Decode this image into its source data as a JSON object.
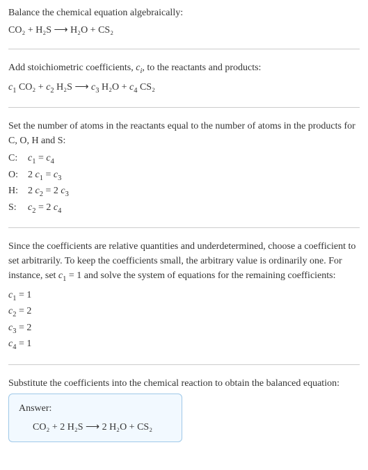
{
  "sec1": {
    "title": "Balance the chemical equation algebraically:",
    "eq": "CO₂ + H₂S ⟶ H₂O + CS₂"
  },
  "sec2": {
    "title_a": "Add stoichiometric coefficients, ",
    "title_ci": "c",
    "title_isub": "i",
    "title_b": ", to the reactants and products:",
    "c1": "c",
    "c1s": "1",
    "r1": " CO₂ + ",
    "c2": "c",
    "c2s": "2",
    "r2": " H₂S ⟶ ",
    "c3": "c",
    "c3s": "3",
    "r3": " H₂O + ",
    "c4": "c",
    "c4s": "4",
    "r4": " CS₂"
  },
  "sec3": {
    "title": "Set the number of atoms in the reactants equal to the number of atoms in the products for C, O, H and S:",
    "rows": [
      {
        "label": "C:",
        "lhs_c": "c",
        "lhs_s": "1",
        "eq": " = ",
        "rhs_c": "c",
        "rhs_s": "4",
        "pre": "",
        "rpre": ""
      },
      {
        "label": "O:",
        "lhs_c": "c",
        "lhs_s": "1",
        "eq": " = ",
        "rhs_c": "c",
        "rhs_s": "3",
        "pre": "2 ",
        "rpre": ""
      },
      {
        "label": "H:",
        "lhs_c": "c",
        "lhs_s": "2",
        "eq": " = ",
        "rhs_c": "c",
        "rhs_s": "3",
        "pre": "2 ",
        "rpre": "2 "
      },
      {
        "label": "S:",
        "lhs_c": "c",
        "lhs_s": "2",
        "eq": " = ",
        "rhs_c": "c",
        "rhs_s": "4",
        "pre": "",
        "rpre": "2 "
      }
    ]
  },
  "sec4": {
    "text_a": "Since the coefficients are relative quantities and underdetermined, choose a coefficient to set arbitrarily. To keep the coefficients small, the arbitrary value is ordinarily one. For instance, set ",
    "c1": "c",
    "c1s": "1",
    "text_b": " = 1 and solve the system of equations for the remaining coefficients:",
    "lines": [
      {
        "c": "c",
        "s": "1",
        "v": " = 1"
      },
      {
        "c": "c",
        "s": "2",
        "v": " = 2"
      },
      {
        "c": "c",
        "s": "3",
        "v": " = 2"
      },
      {
        "c": "c",
        "s": "4",
        "v": " = 1"
      }
    ]
  },
  "sec5": {
    "title": "Substitute the coefficients into the chemical reaction to obtain the balanced equation:",
    "answer_label": "Answer:",
    "answer_eq": "CO₂ + 2 H₂S ⟶ 2 H₂O + CS₂"
  },
  "chart_data": {
    "type": "table",
    "title": "Balancing CO2 + H2S -> H2O + CS2",
    "atom_balance": [
      {
        "element": "C",
        "equation": "c1 = c4"
      },
      {
        "element": "O",
        "equation": "2 c1 = c3"
      },
      {
        "element": "H",
        "equation": "2 c2 = 2 c3"
      },
      {
        "element": "S",
        "equation": "c2 = 2 c4"
      }
    ],
    "solution": {
      "c1": 1,
      "c2": 2,
      "c3": 2,
      "c4": 1
    },
    "balanced": "CO2 + 2 H2S -> 2 H2O + CS2"
  }
}
